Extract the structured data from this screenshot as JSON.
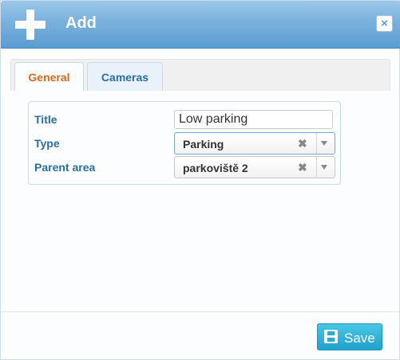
{
  "dialog": {
    "title": "Add",
    "close_icon": "close-icon",
    "add_icon": "plus-icon"
  },
  "tabs": [
    {
      "label": "General",
      "active": true
    },
    {
      "label": "Cameras",
      "active": false
    }
  ],
  "form": {
    "title_label": "Title",
    "title_value": "Low parking",
    "type_label": "Type",
    "type_value": "Parking",
    "parent_label": "Parent area",
    "parent_value": "parkoviště 2"
  },
  "footer": {
    "save_label": "Save",
    "save_icon": "floppy-disk-icon"
  },
  "colors": {
    "header": "#79b1dd",
    "active_tab_text": "#d2691e",
    "label_text": "#2a6da8",
    "save_button": "#21a2cc"
  }
}
